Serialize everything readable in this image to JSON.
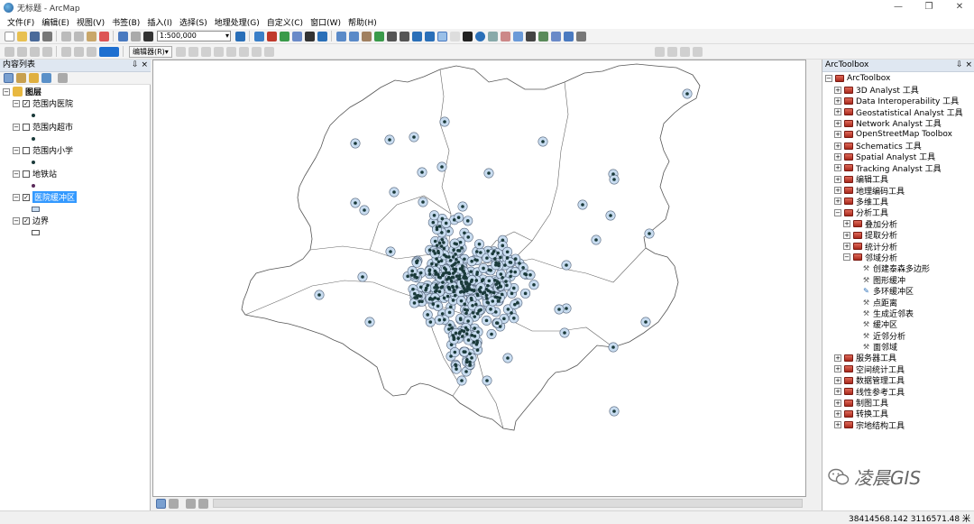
{
  "window": {
    "title": "无标题 - ArcMap",
    "minimize": "—",
    "restore": "❐",
    "close": "✕"
  },
  "menu": [
    "文件(F)",
    "编辑(E)",
    "视图(V)",
    "书签(B)",
    "插入(I)",
    "选择(S)",
    "地理处理(G)",
    "自定义(C)",
    "窗口(W)",
    "帮助(H)"
  ],
  "toolbar": {
    "scale": "1:500,000",
    "editor_label": "编辑器(R)▾"
  },
  "toc": {
    "title": "内容列表",
    "pin": "⇩ ×",
    "layers_group": "图层",
    "layers": [
      {
        "name": "范围内医院",
        "checked": true,
        "symbol": "dot",
        "selected": false
      },
      {
        "name": "范围内超市",
        "checked": false,
        "symbol": "dot",
        "selected": false
      },
      {
        "name": "范围内小学",
        "checked": false,
        "symbol": "dot",
        "selected": false
      },
      {
        "name": "地铁站",
        "checked": false,
        "symbol": "dot-purple",
        "selected": false
      },
      {
        "name": "医院缓冲区",
        "checked": true,
        "symbol": "rect-blue",
        "selected": true
      },
      {
        "name": "边界",
        "checked": true,
        "symbol": "rect-white",
        "selected": false
      }
    ]
  },
  "arctoolbox": {
    "title": "ArcToolbox",
    "pin": "⇩ ×",
    "root": "ArcToolbox",
    "items": [
      {
        "label": "3D Analyst 工具",
        "level": 1,
        "type": "box"
      },
      {
        "label": "Data Interoperability 工具",
        "level": 1,
        "type": "box"
      },
      {
        "label": "Geostatistical Analyst 工具",
        "level": 1,
        "type": "box"
      },
      {
        "label": "Network Analyst 工具",
        "level": 1,
        "type": "box"
      },
      {
        "label": "OpenStreetMap Toolbox",
        "level": 1,
        "type": "box"
      },
      {
        "label": "Schematics 工具",
        "level": 1,
        "type": "box"
      },
      {
        "label": "Spatial Analyst 工具",
        "level": 1,
        "type": "box"
      },
      {
        "label": "Tracking Analyst 工具",
        "level": 1,
        "type": "box"
      },
      {
        "label": "编辑工具",
        "level": 1,
        "type": "box"
      },
      {
        "label": "地理编码工具",
        "level": 1,
        "type": "box"
      },
      {
        "label": "多维工具",
        "level": 1,
        "type": "box"
      },
      {
        "label": "分析工具",
        "level": 1,
        "type": "box",
        "expanded": true
      },
      {
        "label": "叠加分析",
        "level": 2,
        "type": "box"
      },
      {
        "label": "提取分析",
        "level": 2,
        "type": "box"
      },
      {
        "label": "统计分析",
        "level": 2,
        "type": "box"
      },
      {
        "label": "邻域分析",
        "level": 2,
        "type": "box",
        "expanded": true
      },
      {
        "label": "创建泰森多边形",
        "level": 3,
        "type": "tool"
      },
      {
        "label": "图形缓冲",
        "level": 3,
        "type": "tool"
      },
      {
        "label": "多环缓冲区",
        "level": 3,
        "type": "script"
      },
      {
        "label": "点距离",
        "level": 3,
        "type": "tool"
      },
      {
        "label": "生成近邻表",
        "level": 3,
        "type": "tool"
      },
      {
        "label": "缓冲区",
        "level": 3,
        "type": "tool"
      },
      {
        "label": "近邻分析",
        "level": 3,
        "type": "tool"
      },
      {
        "label": "面邻域",
        "level": 3,
        "type": "tool"
      },
      {
        "label": "服务器工具",
        "level": 1,
        "type": "box"
      },
      {
        "label": "空间统计工具",
        "level": 1,
        "type": "box"
      },
      {
        "label": "数据管理工具",
        "level": 1,
        "type": "box"
      },
      {
        "label": "线性参考工具",
        "level": 1,
        "type": "box"
      },
      {
        "label": "制图工具",
        "level": 1,
        "type": "box"
      },
      {
        "label": "转换工具",
        "level": 1,
        "type": "box"
      },
      {
        "label": "宗地结构工具",
        "level": 1,
        "type": "box"
      }
    ]
  },
  "status": {
    "coordinates": "38414568.142  3116571.48 米"
  },
  "watermark": {
    "text": "凌晨GIS"
  },
  "colors": {
    "buffer_fill": "#c8dcf0",
    "buffer_stroke": "#5a6a80",
    "point": "#1a3a3a",
    "selection": "#3399ff",
    "toolbox_red": "#c0392b"
  }
}
